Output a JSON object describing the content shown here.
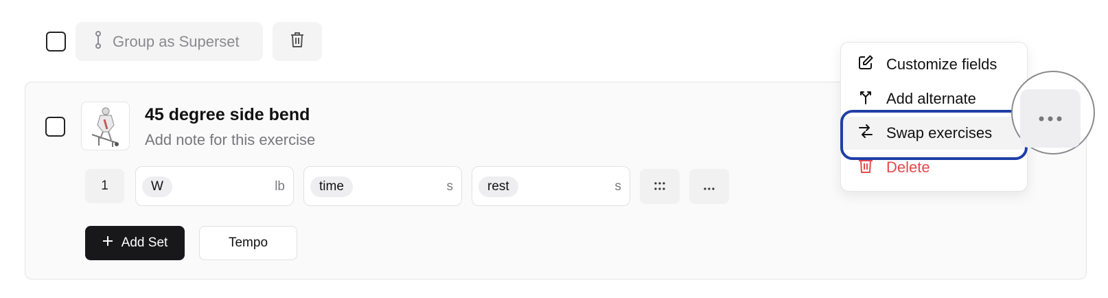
{
  "toolbar": {
    "superset_label": "Group as Superset",
    "superset_icon": "link-icon",
    "delete_icon": "trash-icon"
  },
  "exercise": {
    "title": "45 degree side bend",
    "note_placeholder": "Add note for this exercise",
    "sets": [
      {
        "number": "1",
        "fields": [
          {
            "tag": "W",
            "unit": "lb"
          },
          {
            "tag": "time",
            "unit": "s"
          },
          {
            "tag": "rest",
            "unit": "s"
          }
        ]
      }
    ],
    "add_set_label": "Add Set",
    "tempo_label": "Tempo"
  },
  "menu": {
    "items": [
      {
        "label": "Customize fields",
        "icon": "edit-icon"
      },
      {
        "label": "Add alternate",
        "icon": "fork-icon"
      },
      {
        "label": "Swap exercises",
        "icon": "swap-icon"
      },
      {
        "label": "Delete",
        "icon": "trash-icon"
      }
    ]
  },
  "colors": {
    "accent_dark": "#18181b",
    "danger": "#e5484d",
    "highlight": "#1f3fa6"
  }
}
